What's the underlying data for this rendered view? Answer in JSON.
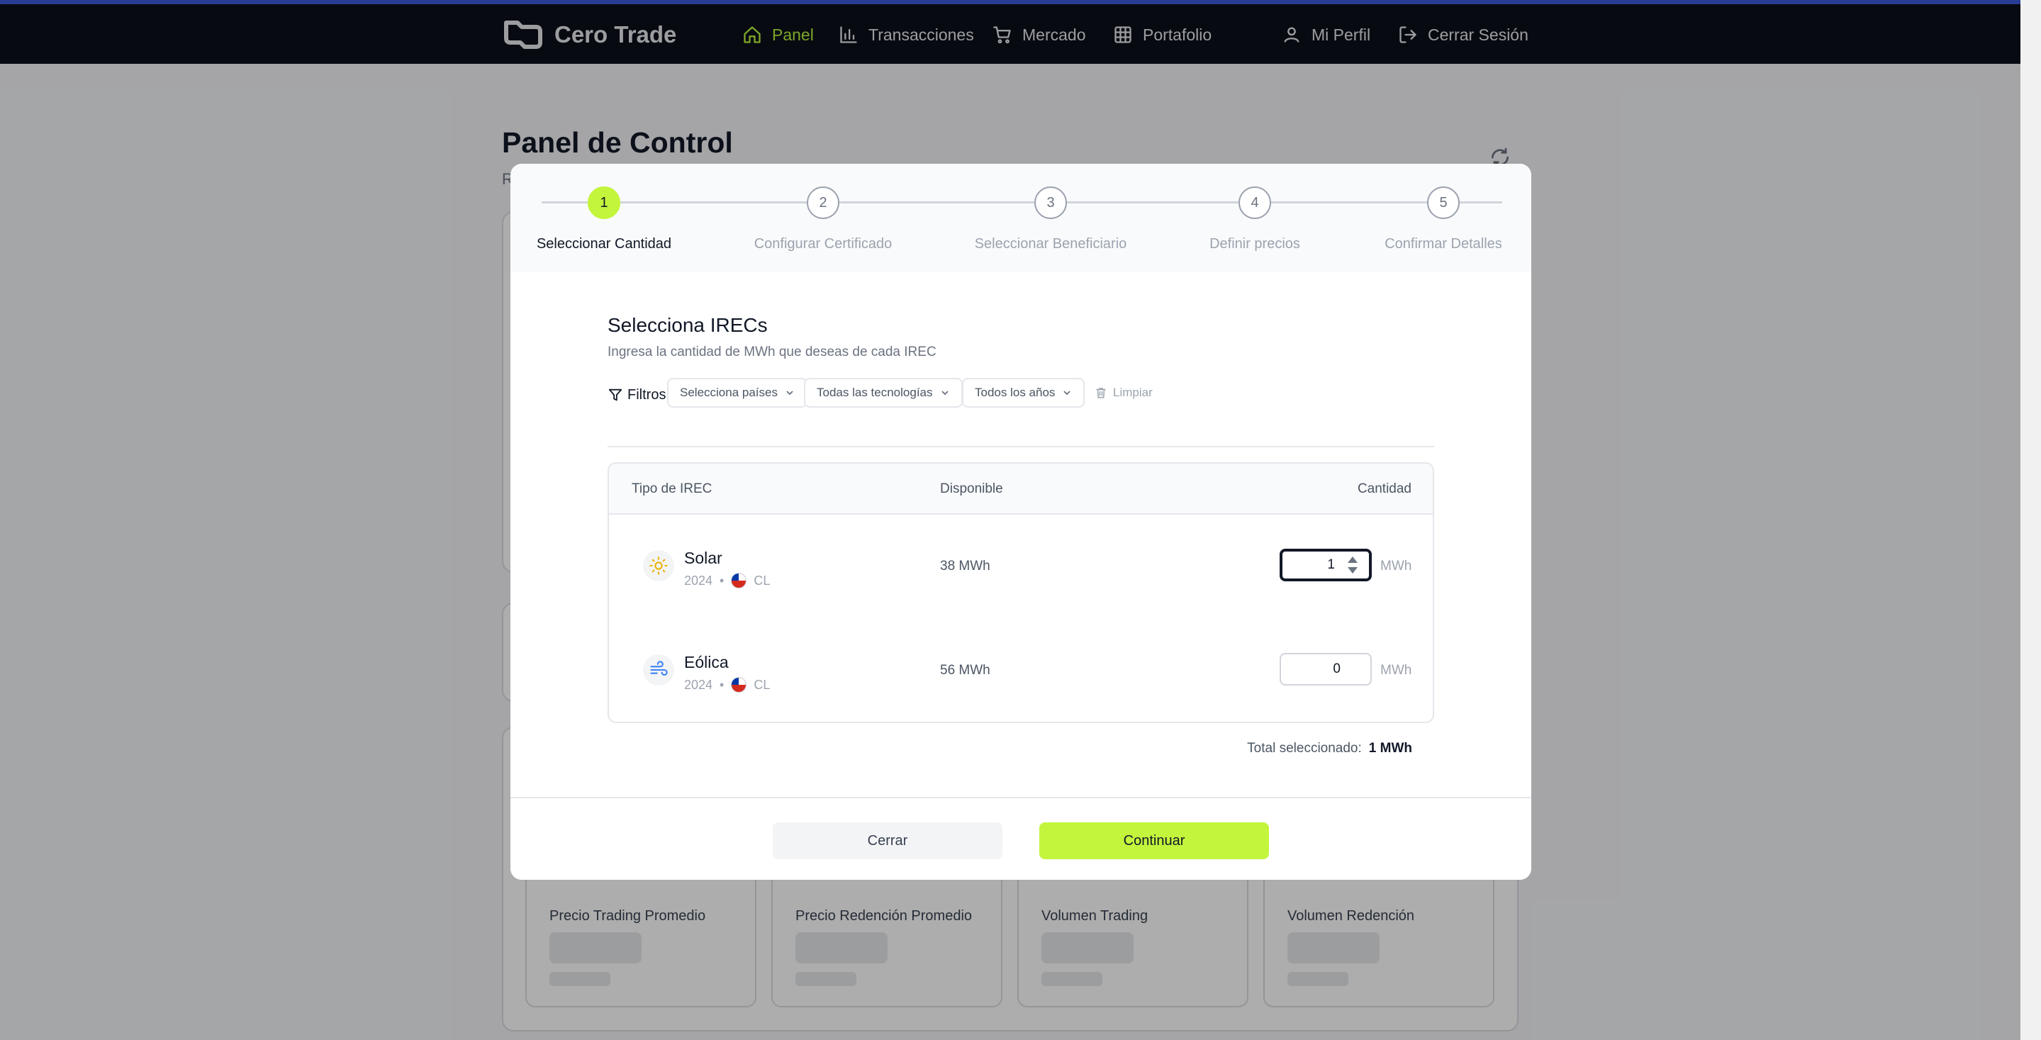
{
  "nav": {
    "brand": "Cero Trade",
    "items": [
      {
        "label": "Panel",
        "icon": "home-icon",
        "active": true
      },
      {
        "label": "Transacciones",
        "icon": "bar-chart-icon"
      },
      {
        "label": "Mercado",
        "icon": "cart-icon"
      },
      {
        "label": "Portafolio",
        "icon": "grid-icon"
      }
    ],
    "profile": "Mi Perfil",
    "logout": "Cerrar Sesión"
  },
  "page": {
    "title": "Panel de Control",
    "subtitle_fragment": "R",
    "stat_cards": [
      "Precio Trading Promedio",
      "Precio Redención Promedio",
      "Volumen Trading",
      "Volumen Redención"
    ]
  },
  "modal": {
    "steps": [
      {
        "number": "1",
        "label": "Seleccionar Cantidad",
        "active": true
      },
      {
        "number": "2",
        "label": "Configurar Certificado"
      },
      {
        "number": "3",
        "label": "Seleccionar Beneficiario"
      },
      {
        "number": "4",
        "label": "Definir precios"
      },
      {
        "number": "5",
        "label": "Confirmar Detalles"
      }
    ],
    "title": "Selecciona IRECs",
    "subtitle": "Ingresa la cantidad de MWh que deseas de cada IREC",
    "filters": {
      "label": "Filtros:",
      "countries": "Selecciona países",
      "technologies": "Todas las tecnologías",
      "years": "Todos los años",
      "clear": "Limpiar"
    },
    "table": {
      "headers": {
        "type": "Tipo de IREC",
        "available": "Disponible",
        "quantity": "Cantidad"
      },
      "rows": [
        {
          "name": "Solar",
          "year": "2024",
          "country": "CL",
          "available": "38 MWh",
          "quantity": "1",
          "unit": "MWh",
          "icon": "sun-icon"
        },
        {
          "name": "Eólica",
          "year": "2024",
          "country": "CL",
          "available": "56 MWh",
          "quantity": "0",
          "unit": "MWh",
          "icon": "wind-icon"
        }
      ]
    },
    "total_label": "Total seleccionado:",
    "total_value": "1 MWh",
    "close_button": "Cerrar",
    "continue_button": "Continuar"
  },
  "colors": {
    "accent": "#c3f53c",
    "nav_bg": "#0b0f1a",
    "nav_active": "#b9f33a"
  }
}
